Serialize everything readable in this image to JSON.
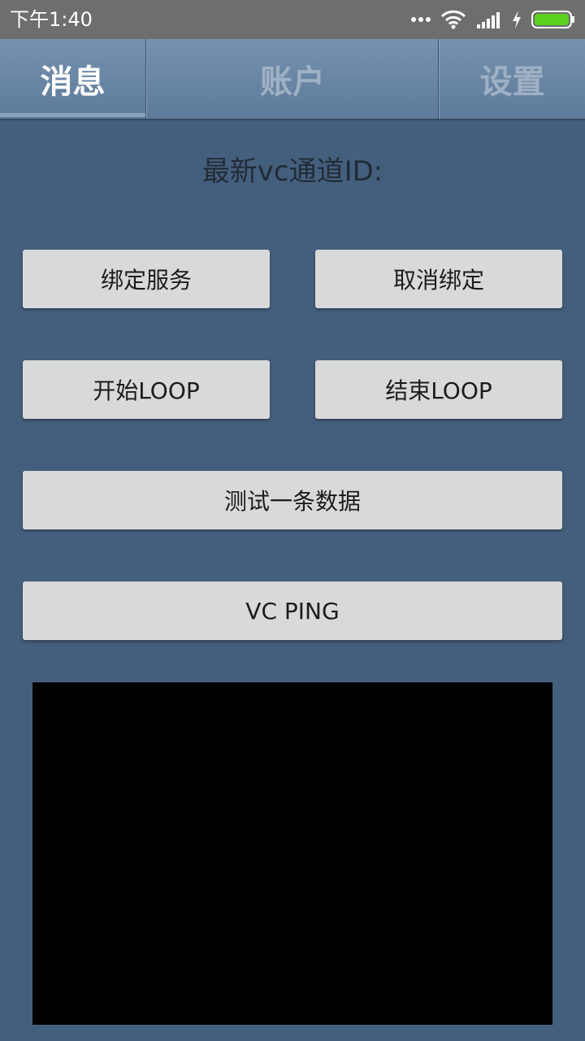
{
  "status_bar": {
    "time": "下午1:40",
    "icons": [
      "more-icon",
      "wifi-icon",
      "signal-icon",
      "charging-icon",
      "battery-icon"
    ],
    "battery_color": "#5bd11e"
  },
  "tabs": [
    {
      "label": "消息",
      "active": true
    },
    {
      "label": "账户",
      "active": false
    },
    {
      "label": "设置",
      "active": false
    }
  ],
  "content": {
    "channel_label": "最新vc通道ID:",
    "buttons": {
      "bind": "绑定服务",
      "unbind": "取消绑定",
      "start_loop": "开始LOOP",
      "end_loop": "结束LOOP",
      "test_data": "测试一条数据",
      "vc_ping": "VC PING"
    }
  },
  "colors": {
    "background": "#445f7d",
    "button": "#d8d9d9",
    "status_bar": "#6e6e6e"
  }
}
